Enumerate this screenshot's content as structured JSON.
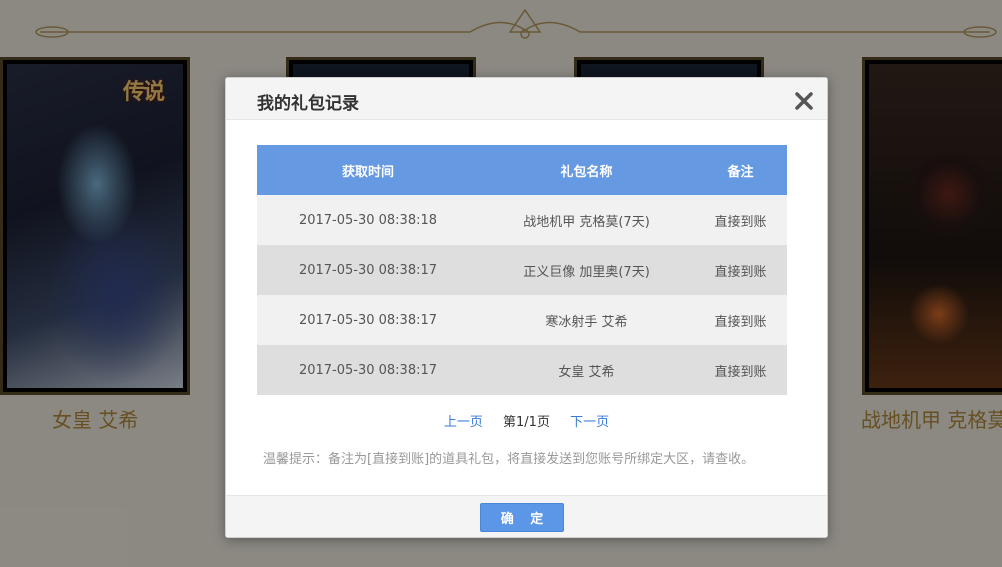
{
  "background": {
    "cards": [
      {
        "name": "女皇 艾希",
        "logo": "传说"
      },
      {
        "name": ""
      },
      {
        "name": ""
      },
      {
        "name": "战地机甲 克格莫"
      }
    ]
  },
  "modal": {
    "title": "我的礼包记录",
    "close_icon": "close-icon",
    "table": {
      "headers": [
        "获取时间",
        "礼包名称",
        "备注"
      ],
      "rows": [
        {
          "time": "2017-05-30 08:38:18",
          "name": "战地机甲 克格莫(7天)",
          "note": "直接到账"
        },
        {
          "time": "2017-05-30 08:38:17",
          "name": "正义巨像 加里奥(7天)",
          "note": "直接到账"
        },
        {
          "time": "2017-05-30 08:38:17",
          "name": "寒冰射手 艾希",
          "note": "直接到账"
        },
        {
          "time": "2017-05-30 08:38:17",
          "name": "女皇 艾希",
          "note": "直接到账"
        }
      ]
    },
    "pager": {
      "prev": "上一页",
      "current": "第1/1页",
      "next": "下一页"
    },
    "tip": "温馨提示：备注为[直接到账]的道具礼包，将直接发送到您账号所绑定大区，请查收。",
    "confirm_label": "确 定"
  },
  "colors": {
    "header_blue": "#6599e2",
    "button_blue": "#5b97e6",
    "link_blue": "#3a7ad9",
    "name_gold": "#b08a3c"
  }
}
